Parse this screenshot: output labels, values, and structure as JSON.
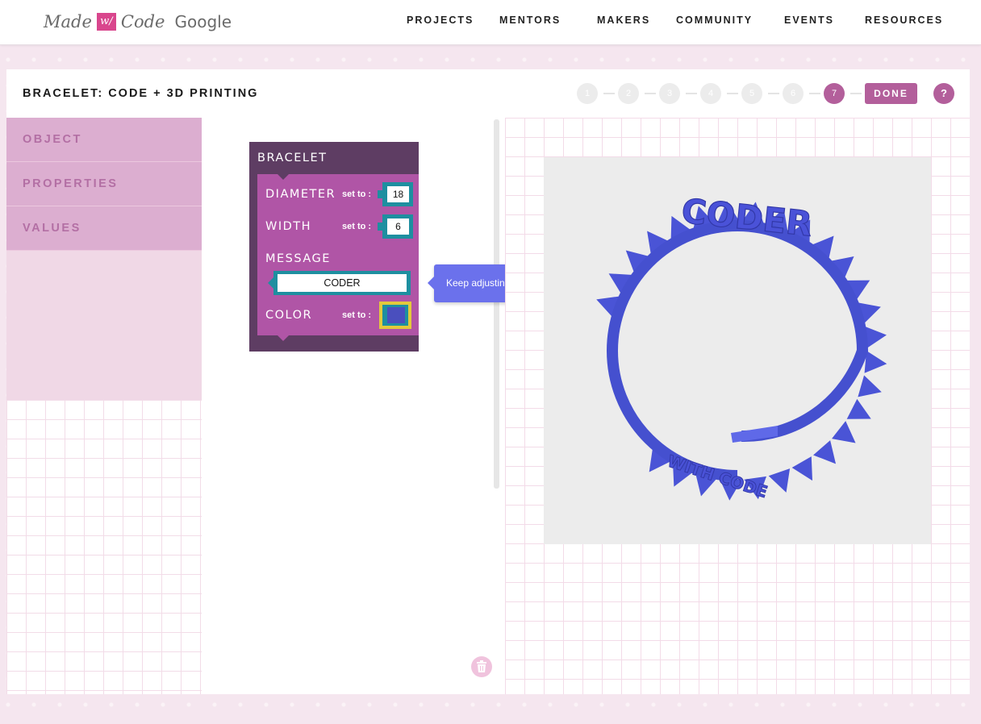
{
  "header": {
    "logo": {
      "made": "Made",
      "w": "w/",
      "code": "Code",
      "google": "Google"
    },
    "nav": [
      "PROJECTS",
      "MENTORS",
      "MAKERS",
      "COMMUNITY",
      "EVENTS",
      "RESOURCES"
    ]
  },
  "titlebar": {
    "title": "BRACELET: CODE + 3D PRINTING",
    "steps": [
      "1",
      "2",
      "3",
      "4",
      "5",
      "6",
      "7"
    ],
    "active_step": "7",
    "done_label": "DONE",
    "help_label": "?"
  },
  "categories": [
    "OBJECT",
    "PROPERTIES",
    "VALUES"
  ],
  "block": {
    "title": "BRACELET",
    "rows": {
      "diameter": {
        "label": "DIAMETER",
        "set_to": "set to :",
        "value": "18"
      },
      "width": {
        "label": "WIDTH",
        "set_to": "set to :",
        "value": "6"
      },
      "message": {
        "label": "MESSAGE",
        "value": "CODER"
      },
      "color": {
        "label": "COLOR",
        "set_to": "set to :",
        "swatch": "#4a4fbe"
      }
    }
  },
  "tooltip": {
    "message": "Keep adjusting your message until you're happy.",
    "close": "×"
  },
  "preview": {
    "bracelet_text": "CODER",
    "bracelet_color": "#5762e0"
  },
  "colors": {
    "accent": "#b35f9b",
    "block_dark": "#5e3d63",
    "block_body": "#b055a6",
    "slot": "#1e8fa0",
    "tooltip": "#6b71ec"
  }
}
